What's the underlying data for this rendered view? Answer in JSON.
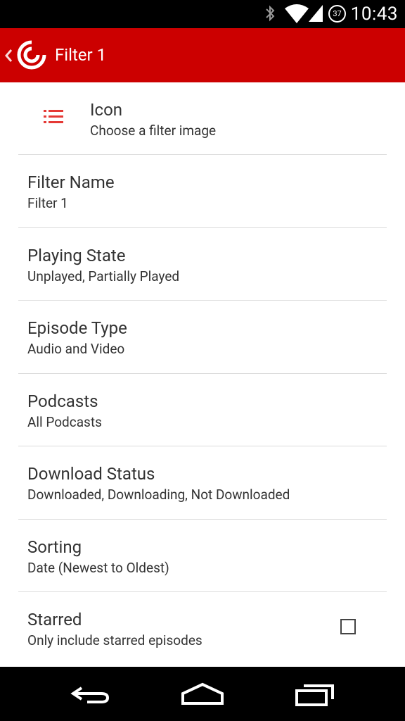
{
  "status_bar": {
    "time": "10:43",
    "battery_level": "37",
    "icons": [
      "bluetooth-icon",
      "wifi-icon",
      "cell-signal-icon",
      "battery-icon"
    ]
  },
  "app_bar": {
    "title": "Filter 1",
    "color": "#cc0000"
  },
  "settings": {
    "icon": {
      "title": "Icon",
      "subtitle": "Choose a filter image"
    },
    "filter_name": {
      "title": "Filter Name",
      "subtitle": "Filter 1"
    },
    "playing_state": {
      "title": "Playing State",
      "subtitle": "Unplayed, Partially Played"
    },
    "episode_type": {
      "title": "Episode Type",
      "subtitle": "Audio and Video"
    },
    "podcasts": {
      "title": "Podcasts",
      "subtitle": "All Podcasts"
    },
    "download_status": {
      "title": "Download Status",
      "subtitle": "Downloaded, Downloading, Not Downloaded"
    },
    "sorting": {
      "title": "Sorting",
      "subtitle": "Date (Newest to Oldest)"
    },
    "starred": {
      "title": "Starred",
      "subtitle": "Only include starred episodes",
      "checked": false
    }
  },
  "nav_bar": {
    "buttons": [
      "back-icon",
      "home-icon",
      "recents-icon"
    ]
  }
}
